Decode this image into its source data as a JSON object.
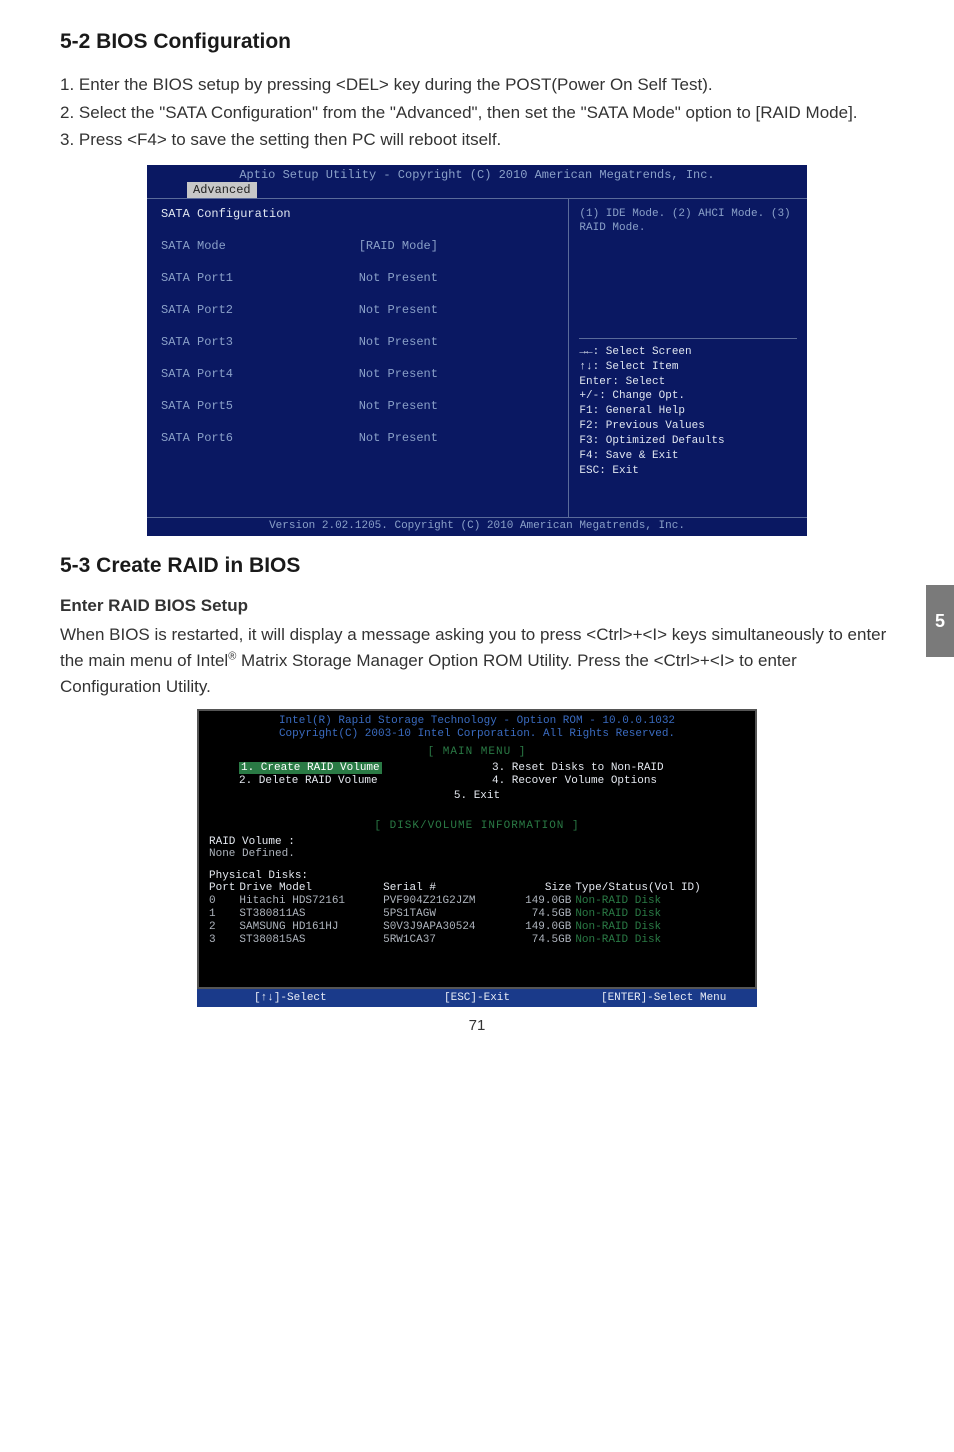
{
  "section1": {
    "heading": "5-2 BIOS Configuration",
    "steps": [
      "1. Enter the BIOS setup by pressing <DEL> key during the POST(Power On Self Test).",
      "2. Select the \"SATA Configuration\" from the \"Advanced\", then set the \"SATA Mode\"  option to [RAID Mode].",
      "3. Press <F4> to save the setting then PC will reboot itself."
    ]
  },
  "bios": {
    "title": "Aptio Setup Utility - Copyright (C) 2010 American Megatrends, Inc.",
    "tab": "Advanced",
    "rows": [
      {
        "k": "SATA Configuration",
        "v": ""
      },
      {
        "k": "SATA Mode",
        "v": "[RAID Mode]"
      },
      {
        "k": "SATA Port1",
        "v": "Not Present"
      },
      {
        "k": "SATA Port2",
        "v": "Not Present"
      },
      {
        "k": "SATA Port3",
        "v": "Not Present"
      },
      {
        "k": "SATA Port4",
        "v": "Not Present"
      },
      {
        "k": "SATA Port5",
        "v": "Not Present"
      },
      {
        "k": "SATA Port6",
        "v": "Not Present"
      }
    ],
    "info": "(1) IDE Mode. (2) AHCI Mode. (3) RAID Mode.",
    "hints": [
      "→←: Select Screen",
      "↑↓: Select Item",
      "Enter: Select",
      "+/-: Change Opt.",
      "F1: General Help",
      "F2: Previous Values",
      "F3: Optimized Defaults",
      "F4: Save & Exit",
      "ESC: Exit"
    ],
    "footer": "Version 2.02.1205. Copyright (C) 2010 American Megatrends, Inc."
  },
  "section2": {
    "heading": "5-3 Create RAID in BIOS",
    "sub": "Enter  RAID BIOS Setup",
    "para_a": "When BIOS is restarted, it will display a message asking you to press <Ctrl>+<I> keys simultaneously to enter the main menu of Intel",
    "para_reg": "®",
    "para_b": " Matrix Storage Manager Option ROM Utility. Press the <Ctrl>+<I> to enter Configuration Utility."
  },
  "raid": {
    "head1": "Intel(R) Rapid Storage Technology - Option ROM - 10.0.0.1032",
    "head2": "Copyright(C) 2003-10 Intel Corporation.   All Rights Reserved.",
    "mainmenu_label": "[ MAIN MENU ]",
    "menu": {
      "i1": "1. Create RAID Volume",
      "i2": "2. Delete RAID Volume",
      "i3": "3. Reset Disks to Non-RAID",
      "i4": "4. Recover Volume Options",
      "i5": "5. Exit"
    },
    "diskinfo_label": "[ DISK/VOLUME INFORMATION ]",
    "vol_label": "RAID Volume :",
    "vol_none": "None Defined.",
    "phys_label": "Physical Disks:",
    "hd": {
      "port": "Port",
      "model": "Drive Model",
      "serial": "Serial #",
      "size": "Size",
      "type": "Type/Status(Vol ID)"
    },
    "rows": [
      {
        "port": "0",
        "model": "Hitachi HDS72161",
        "serial": "PVF904Z21G2JZM",
        "size": "149.0GB",
        "type": "Non-RAID Disk"
      },
      {
        "port": "1",
        "model": "ST380811AS",
        "serial": "5PS1TAGW",
        "size": "74.5GB",
        "type": "Non-RAID Disk"
      },
      {
        "port": "2",
        "model": "SAMSUNG HD161HJ",
        "serial": "S0V3J9APA30524",
        "size": "149.0GB",
        "type": "Non-RAID Disk"
      },
      {
        "port": "3",
        "model": "ST380815AS",
        "serial": "5RW1CA37",
        "size": "74.5GB",
        "type": "Non-RAID Disk"
      }
    ],
    "foot": {
      "a": "[↑↓]-Select",
      "b": "[ESC]-Exit",
      "c": "[ENTER]-Select Menu"
    }
  },
  "side_tab": "5",
  "page_num": "71"
}
